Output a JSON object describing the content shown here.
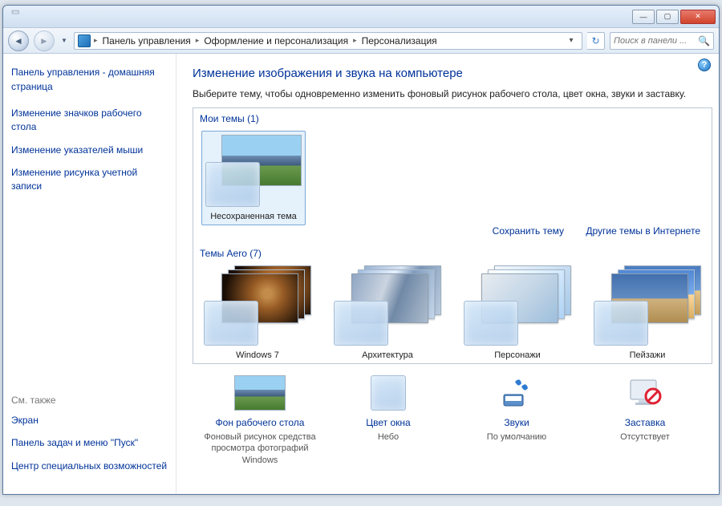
{
  "breadcrumbs": [
    "Панель управления",
    "Оформление и персонализация",
    "Персонализация"
  ],
  "search_placeholder": "Поиск в панели ...",
  "sidebar": {
    "home": "Панель управления - домашняя страница",
    "links": [
      "Изменение значков рабочего стола",
      "Изменение указателей мыши",
      "Изменение рисунка учетной записи"
    ],
    "seealso_label": "См. также",
    "seealso": [
      "Экран",
      "Панель задач и меню \"Пуск\"",
      "Центр специальных возможностей"
    ]
  },
  "main": {
    "heading": "Изменение изображения и звука на компьютере",
    "subtext": "Выберите тему, чтобы одновременно изменить фоновый рисунок рабочего стола, цвет окна, звуки и заставку.",
    "my_themes_label": "Мои темы (1)",
    "unsaved_theme": "Несохраненная тема",
    "save_theme": "Сохранить тему",
    "more_online": "Другие темы в Интернете",
    "aero_label": "Темы Aero (7)",
    "aero": [
      "Windows 7",
      "Архитектура",
      "Персонажи",
      "Пейзажи"
    ]
  },
  "bottom": {
    "desktop": {
      "title": "Фон рабочего стола",
      "sub": "Фоновый рисунок средства просмотра фотографий Windows"
    },
    "color": {
      "title": "Цвет окна",
      "sub": "Небо"
    },
    "sounds": {
      "title": "Звуки",
      "sub": "По умолчанию"
    },
    "saver": {
      "title": "Заставка",
      "sub": "Отсутствует"
    }
  }
}
